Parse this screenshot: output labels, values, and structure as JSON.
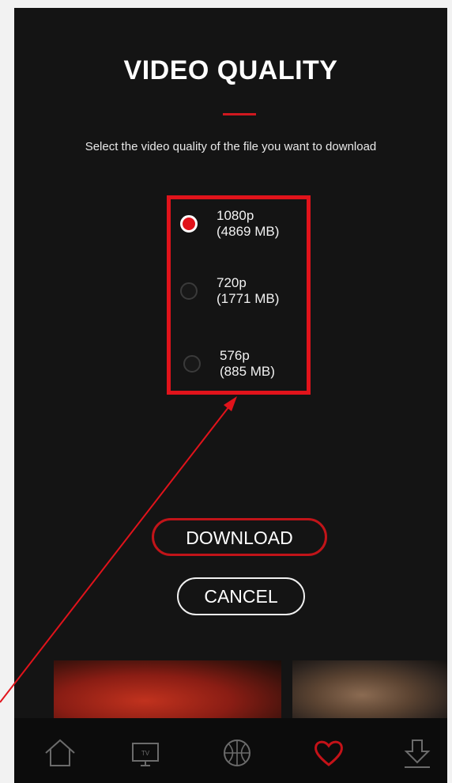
{
  "dialog": {
    "title": "VIDEO QUALITY",
    "subtitle": "Select the video quality of the file you want to download",
    "options": [
      {
        "resolution": "1080p",
        "size": "(4869 MB)",
        "selected": true
      },
      {
        "resolution": "720p",
        "size": "(1771 MB)",
        "selected": false
      },
      {
        "resolution": "576p",
        "size": "(885 MB)",
        "selected": false
      }
    ],
    "download_label": "DOWNLOAD",
    "cancel_label": "CANCEL"
  },
  "nav": {
    "items": [
      {
        "icon": "home-icon"
      },
      {
        "icon": "tv-icon",
        "label": "TV"
      },
      {
        "icon": "basketball-icon"
      },
      {
        "icon": "heart-icon",
        "active": true
      },
      {
        "icon": "download-icon"
      }
    ]
  },
  "colors": {
    "accent": "#e1131b",
    "background": "#141414",
    "annotation": "#e1131b"
  }
}
